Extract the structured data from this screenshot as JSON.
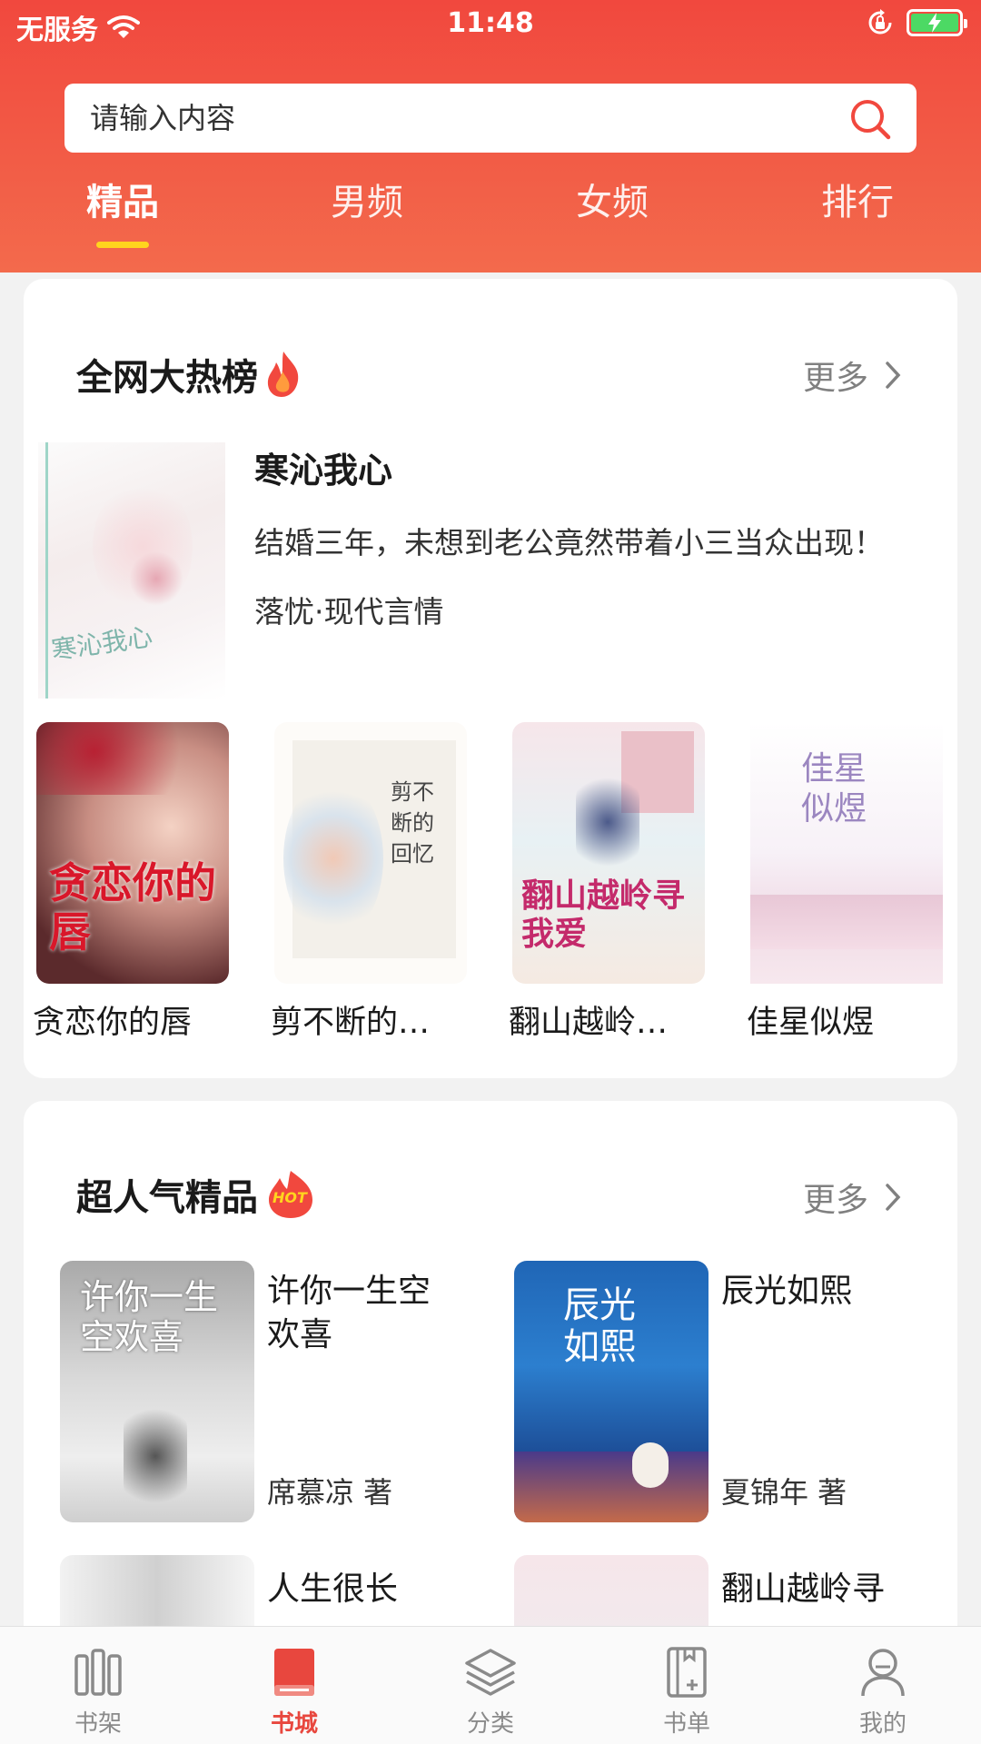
{
  "status_bar": {
    "carrier": "无服务",
    "time": "11:48"
  },
  "search": {
    "placeholder": "请输入内容"
  },
  "tabs": [
    {
      "label": "精品",
      "active": true
    },
    {
      "label": "男频",
      "active": false
    },
    {
      "label": "女频",
      "active": false
    },
    {
      "label": "排行",
      "active": false
    }
  ],
  "hot_section": {
    "title": "全网大热榜",
    "more": "更多",
    "featured": {
      "title": "寒沁我心",
      "description": "结婚三年，未想到老公竟然带着小三当众出现！",
      "meta": "落忧·现代言情",
      "cover_text": "寒沁我心"
    },
    "books": [
      {
        "title": "贪恋你的唇",
        "cover_text": "贪恋你的唇"
      },
      {
        "title": "剪不断的…",
        "cover_text": "剪不断的回忆"
      },
      {
        "title": "翻山越岭…",
        "cover_text": "翻山越岭寻我爱"
      },
      {
        "title": "佳星似煜",
        "cover_text": "佳星似煜"
      }
    ]
  },
  "popular_section": {
    "title": "超人气精品",
    "badge": "HOT",
    "more": "更多",
    "books": [
      {
        "title": "许你一生空欢喜",
        "author": "席慕凉 著",
        "cover_text": "许你一生空欢喜"
      },
      {
        "title": "辰光如熙",
        "author": "夏锦年 著",
        "cover_text": "辰光如熙"
      },
      {
        "title": "人生很长"
      },
      {
        "title": "翻山越岭寻"
      }
    ]
  },
  "bottom_nav": [
    {
      "label": "书架",
      "icon": "bookshelf-icon",
      "active": false
    },
    {
      "label": "书城",
      "icon": "bookstore-icon",
      "active": true
    },
    {
      "label": "分类",
      "icon": "category-icon",
      "active": false
    },
    {
      "label": "书单",
      "icon": "booklist-icon",
      "active": false
    },
    {
      "label": "我的",
      "icon": "profile-icon",
      "active": false
    }
  ],
  "colors": {
    "brand": "#f1483e",
    "indicator": "#ffd51e",
    "nav_active": "#e8473e"
  }
}
